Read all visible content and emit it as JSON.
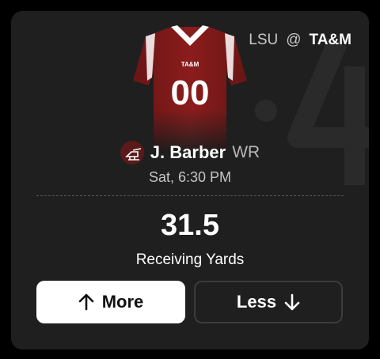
{
  "matchup": {
    "away": "LSU",
    "separator": "@",
    "home": "TA&M"
  },
  "jersey": {
    "team_text": "TA&M",
    "number": "00",
    "color": "#8b1c1c"
  },
  "player": {
    "name": "J. Barber",
    "position": "WR",
    "team_logo_icon": "team-logo-icon"
  },
  "game": {
    "time": "Sat, 6:30 PM"
  },
  "projection": {
    "line": "31.5",
    "stat_type": "Receiving Yards"
  },
  "buttons": {
    "more_label": "More",
    "more_icon": "arrow-up-icon",
    "less_label": "Less",
    "less_icon": "arrow-down-icon"
  },
  "colors": {
    "card_bg": "#1f1f1f",
    "accent_jersey": "#8b1c1c"
  }
}
